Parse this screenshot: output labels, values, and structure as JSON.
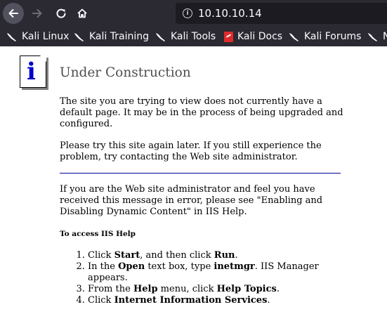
{
  "browser": {
    "url": "10.10.10.14",
    "bookmarks": [
      {
        "label": "Kali Linux",
        "icon": "kali-dragon-icon"
      },
      {
        "label": "Kali Training",
        "icon": "kali-dragon-icon"
      },
      {
        "label": "Kali Tools",
        "icon": "kali-dragon-icon"
      },
      {
        "label": "Kali Docs",
        "icon": "kali-docs-icon"
      },
      {
        "label": "Kali Forums",
        "icon": "kali-dragon-icon"
      },
      {
        "label": "N",
        "icon": "kali-dragon-icon"
      }
    ],
    "colors": {
      "chrome_bg": "#2b2a33",
      "urlbar_bg": "#1c1b22",
      "text": "#fbfbfe"
    }
  },
  "page": {
    "title": "Under Construction",
    "p1": "The site you are trying to view does not currently have a default page. It may be in the process of being upgraded and configured.",
    "p2": "Please try this site again later. If you still experience the problem, try contacting the Web site administrator.",
    "p3": "If you are the Web site administrator and feel you have received this message in error, please see \"Enabling and Disabling Dynamic Content\" in IIS Help.",
    "help_heading": "To access IIS Help",
    "steps": [
      {
        "a": "Click ",
        "b1": "Start",
        "c": ", and then click ",
        "b2": "Run",
        "d": "."
      },
      {
        "a": "In the ",
        "b1": "Open",
        "c": " text box, type ",
        "b2": "inetmgr",
        "d": ". IIS Manager appears."
      },
      {
        "a": "From the ",
        "b1": "Help",
        "c": " menu, click ",
        "b2": "Help Topics",
        "d": "."
      },
      {
        "a": "Click ",
        "b1": "Internet Information Services",
        "c": "",
        "b2": "",
        "d": "."
      }
    ],
    "colors": {
      "title": "#4e4e4e",
      "rule": "#00009a",
      "info_icon": "#0000cc"
    }
  }
}
